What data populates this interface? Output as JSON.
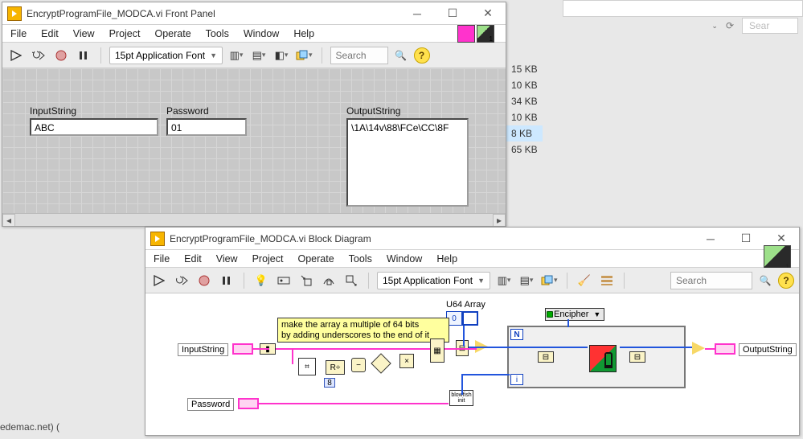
{
  "front_panel": {
    "title": "EncryptProgramFile_MODCA.vi Front Panel",
    "menus": [
      "File",
      "Edit",
      "View",
      "Project",
      "Operate",
      "Tools",
      "Window",
      "Help"
    ],
    "font": "15pt Application Font",
    "search_placeholder": "Search",
    "controls": {
      "input_label": "InputString",
      "input_value": "ABC",
      "password_label": "Password",
      "password_value": "01",
      "output_label": "OutputString",
      "output_value": "\\1A\\14v\\88\\FCe\\CC\\8F"
    }
  },
  "block_diagram": {
    "title": "EncryptProgramFile_MODCA.vi Block Diagram",
    "menus": [
      "File",
      "Edit",
      "View",
      "Project",
      "Operate",
      "Tools",
      "Window",
      "Help"
    ],
    "font": "15pt Application Font",
    "search_placeholder": "Search",
    "comment_l1": "make the array a multiple of 64 bits",
    "comment_l2": "by adding underscores to the end of it",
    "input_label": "InputString",
    "password_label": "Password",
    "output_label": "OutputString",
    "u64_label": "U64 Array",
    "u64_index": "0",
    "ring_value": "Encipher",
    "const8": "8",
    "loop_N": "N",
    "loop_i": "i",
    "blowfish_init": "blowfish init"
  },
  "file_sizes": [
    "15 KB",
    "10 KB",
    "34 KB",
    "10 KB",
    "8 KB",
    "65 KB"
  ],
  "edge_text": "edemac.net) ("
}
